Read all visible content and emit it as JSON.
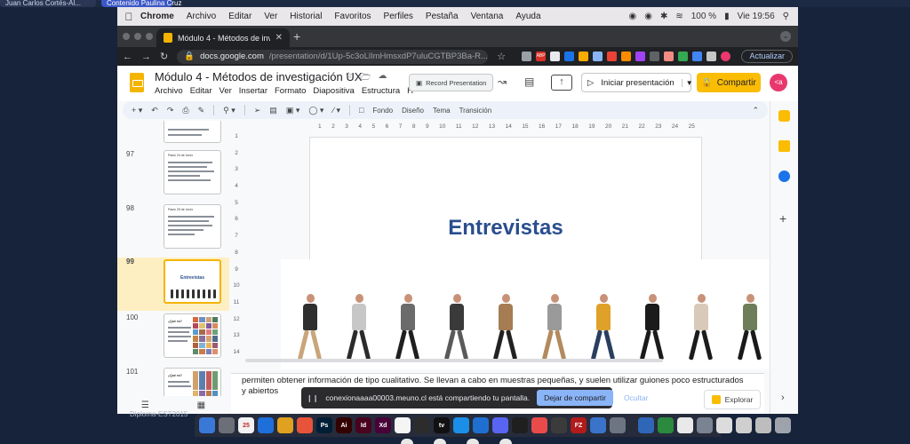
{
  "call_tiles": [
    "Juan Carlos Cortés-Al...",
    "Contenido Paulina Cruz"
  ],
  "menubar": {
    "app": "Chrome",
    "items": [
      "Archivo",
      "Editar",
      "Ver",
      "Historial",
      "Favoritos",
      "Perfiles",
      "Pestaña",
      "Ventana",
      "Ayuda"
    ],
    "battery": "100 %",
    "clock": "Vie 19:56"
  },
  "browser": {
    "tab_title": "Módulo 4 - Métodos de investig",
    "url_domain": "docs.google.com",
    "url_path": "/presentation/d/1Up-5c3oLlImHmsxdP7uluCGTBP3Ba-R...",
    "update_label": "Actualizar",
    "ext_abp": "ABP"
  },
  "slides": {
    "doc_title": "Módulo 4 - Métodos de investigación UX",
    "menus": [
      "Archivo",
      "Editar",
      "Ver",
      "Insertar",
      "Formato",
      "Diapositiva",
      "Estructura",
      "H"
    ],
    "record_label": "Record Presentation",
    "present_label": "Iniciar presentación",
    "share_label": "Compartir",
    "avatar_text": "<a",
    "edit_toolbar": [
      "Fondo",
      "Diseño",
      "Tema",
      "Transición"
    ],
    "ruler_h": [
      "1",
      "2",
      "3",
      "4",
      "5",
      "6",
      "7",
      "8",
      "9",
      "10",
      "11",
      "12",
      "13",
      "14",
      "15",
      "16",
      "17",
      "18",
      "19",
      "20",
      "21",
      "22",
      "23",
      "24",
      "25"
    ],
    "ruler_v": [
      "1",
      "2",
      "3",
      "4",
      "5",
      "6",
      "7",
      "8",
      "9",
      "10",
      "11",
      "12",
      "13",
      "14"
    ],
    "thumbs": [
      {
        "num": "97",
        "head": "Paulo 24 de Junio"
      },
      {
        "num": "98",
        "head": "Paulo 25 de Junio"
      },
      {
        "num": "99",
        "head": "Entrevistas"
      },
      {
        "num": "100",
        "head": "¿Qué es?"
      },
      {
        "num": "101",
        "head": "¿Qué es?"
      }
    ],
    "slide_title": "Entrevistas",
    "notes_line1": "permiten obtener información de tipo cualitativo. Se llevan a cabo en muestras pequeñas, y suelen utilizar guiones poco estructurados",
    "notes_line2": "y abiertos",
    "explore_label": "Explorar"
  },
  "share_banner": {
    "text": "conexionaaaa00003.meuno.cl está compartiendo tu pantalla.",
    "stop_label": "Dejar de compartir",
    "hide_label": "Ocultar"
  },
  "corner_label": "Diploma-EST2015",
  "dock": {
    "calendar_day": "25",
    "apps": [
      {
        "label": "",
        "color": "#3a78d8"
      },
      {
        "label": "",
        "color": "#6c6f78"
      },
      {
        "label": "25",
        "color": "#f2f2f2"
      },
      {
        "label": "",
        "color": "#1e6fd9"
      },
      {
        "label": "",
        "color": "#e0a020"
      },
      {
        "label": "",
        "color": "#e8543a"
      },
      {
        "label": "Ps",
        "color": "#001e36"
      },
      {
        "label": "Ai",
        "color": "#330000"
      },
      {
        "label": "Id",
        "color": "#49021f"
      },
      {
        "label": "Xd",
        "color": "#470137"
      },
      {
        "label": "",
        "color": "#f5f5f5"
      },
      {
        "label": "",
        "color": "#2c2c2c"
      },
      {
        "label": "tv",
        "color": "#111111"
      },
      {
        "label": "",
        "color": "#1b8fe8"
      },
      {
        "label": "",
        "color": "#1f6fd0"
      },
      {
        "label": "",
        "color": "#5865f2"
      },
      {
        "label": "",
        "color": "#1f1f1f"
      },
      {
        "label": "",
        "color": "#e94b4b"
      },
      {
        "label": "",
        "color": "#3b3b3b"
      },
      {
        "label": "FZ",
        "color": "#b31b1b"
      },
      {
        "label": "",
        "color": "#3a73c9"
      },
      {
        "label": "",
        "color": "#6e7582"
      },
      {
        "label": "",
        "color": "#2f66b8"
      },
      {
        "label": "",
        "color": "#2b8a3e"
      },
      {
        "label": "",
        "color": "#e9e9e9"
      },
      {
        "label": "",
        "color": "#7a8391"
      },
      {
        "label": "",
        "color": "#dcdcdc"
      },
      {
        "label": "",
        "color": "#cfcfcf"
      },
      {
        "label": "",
        "color": "#bdbdbd"
      },
      {
        "label": "",
        "color": "#9ea3ab"
      }
    ]
  },
  "colors": {
    "accent_yellow": "#fbbc04",
    "title_blue": "#2a4e8e",
    "avatar_pink": "#e8386d",
    "stop_blue": "#8ab4f8"
  }
}
